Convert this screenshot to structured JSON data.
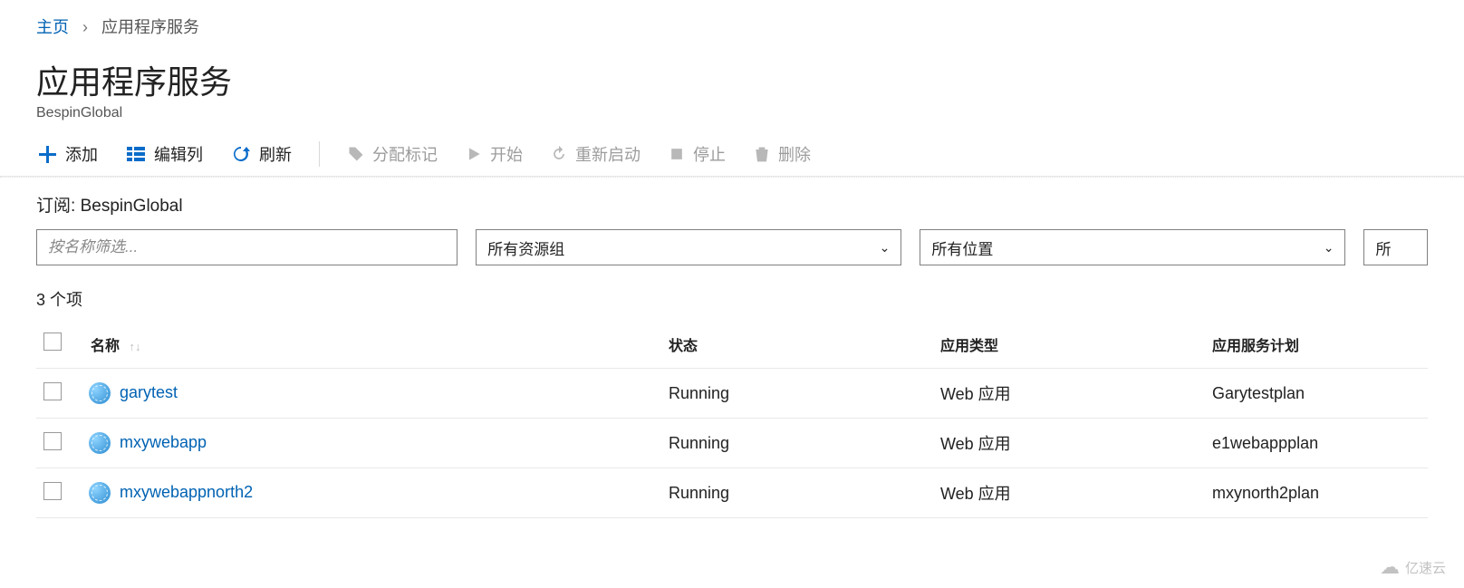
{
  "breadcrumb": {
    "home": "主页",
    "current": "应用程序服务"
  },
  "header": {
    "title": "应用程序服务",
    "subtitle": "BespinGlobal"
  },
  "toolbar": {
    "add": "添加",
    "edit_columns": "编辑列",
    "refresh": "刷新",
    "assign_tags": "分配标记",
    "start": "开始",
    "restart": "重新启动",
    "stop": "停止",
    "delete": "删除"
  },
  "subscription": {
    "label": "订阅",
    "value": "BespinGlobal"
  },
  "filters": {
    "name_placeholder": "按名称筛选...",
    "resource_group": "所有资源组",
    "location": "所有位置",
    "more": "所"
  },
  "count_text": "3 个项",
  "columns": {
    "name": "名称",
    "status": "状态",
    "app_type": "应用类型",
    "plan": "应用服务计划"
  },
  "rows": [
    {
      "name": "garytest",
      "status": "Running",
      "app_type": "Web 应用",
      "plan": "Garytestplan"
    },
    {
      "name": "mxywebapp",
      "status": "Running",
      "app_type": "Web 应用",
      "plan": "e1webappplan"
    },
    {
      "name": "mxywebappnorth2",
      "status": "Running",
      "app_type": "Web 应用",
      "plan": "mxynorth2plan"
    }
  ],
  "watermark": "亿速云"
}
